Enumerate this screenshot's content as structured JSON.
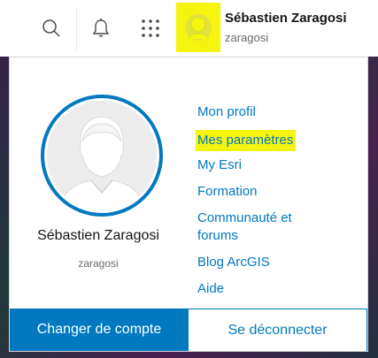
{
  "header": {
    "icons": [
      "search-icon",
      "bell-icon",
      "apps-grid-icon"
    ],
    "user_full_name": "Sébastien Zaragosi",
    "username": "zaragosi"
  },
  "profile_panel": {
    "full_name": "Sébastien Zaragosi",
    "username": "zaragosi",
    "links": [
      {
        "label": "Mon profil",
        "highlighted": false
      },
      {
        "label": "Mes paramètres",
        "highlighted": true
      },
      {
        "label": "My Esri",
        "highlighted": false
      },
      {
        "label": "Formation",
        "highlighted": false
      },
      {
        "label": "Communauté et",
        "label_line2": "forums",
        "highlighted": false
      },
      {
        "label": "Blog ArcGIS",
        "highlighted": false
      },
      {
        "label": "Aide",
        "highlighted": false
      }
    ],
    "switch_account_label": "Changer de compte",
    "sign_out_label": "Se déconnecter"
  },
  "colors": {
    "accent": "#0079c1",
    "highlight": "#f4f40f"
  }
}
